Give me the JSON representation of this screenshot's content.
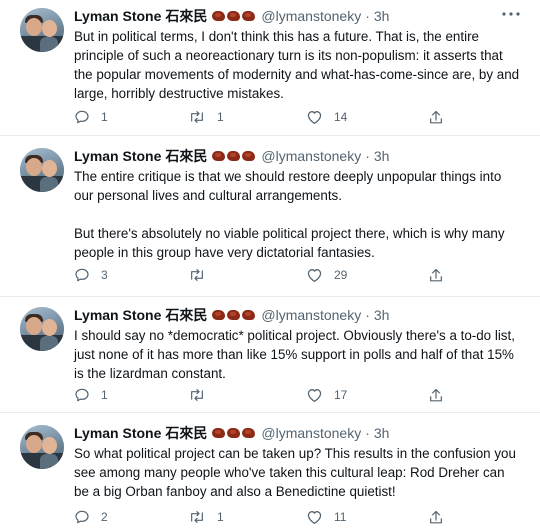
{
  "author": {
    "name": "Lyman Stone",
    "cjk_name": "石來民",
    "handle": "@lymanstoneky",
    "flag_count": 3
  },
  "tweets": [
    {
      "time": "3h",
      "text": "But in political terms, I don't think this has a future. That is, the entire principle of such a neoreactionary turn is its non-populism: it asserts that the popular movements of modernity and what-has-come-since are, by and large, horribly destructive mistakes.",
      "replies": "1",
      "retweets": "1",
      "likes": "14"
    },
    {
      "time": "3h",
      "text": "The entire critique is that we should restore deeply unpopular things into our personal lives and cultural arrangements.\n\nBut there's absolutely no viable political project there, which is why many people in this group have very dictatorial fantasies.",
      "replies": "3",
      "retweets": "",
      "likes": "29"
    },
    {
      "time": "3h",
      "text": "I should say no *democratic* political project. Obviously there's a to-do list, just none of it has more than like 15% support in polls and half of that 15% is the lizardman constant.",
      "replies": "1",
      "retweets": "",
      "likes": "17"
    },
    {
      "time": "3h",
      "text": "So what political project can be taken up? This results in the confusion you see among many people who've taken this cultural leap: Rod Dreher can be a big Orban fanboy and also a Benedictine quietist!",
      "replies": "2",
      "retweets": "1",
      "likes": "11"
    }
  ],
  "icons": {
    "reply": "reply-icon",
    "retweet": "retweet-icon",
    "like": "heart-icon",
    "share": "share-icon",
    "more": "more-icon"
  },
  "colors": {
    "text": "#0f1419",
    "secondary": "#536471",
    "divider": "#e6ecf0"
  }
}
